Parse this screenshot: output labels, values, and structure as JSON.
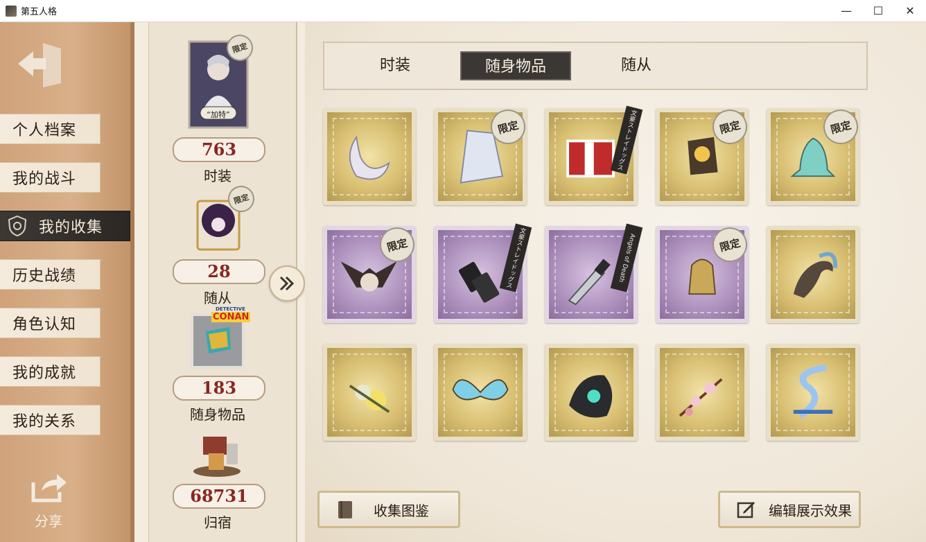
{
  "window": {
    "title": "第五人格",
    "controls": [
      "—",
      "☐",
      "✕"
    ]
  },
  "sidebar": {
    "items": [
      {
        "label": "个人档案",
        "active": false
      },
      {
        "label": "我的战斗",
        "active": false
      },
      {
        "label": "我的收集",
        "active": true
      },
      {
        "label": "历史战绩",
        "active": false
      },
      {
        "label": "角色认知",
        "active": false
      },
      {
        "label": "我的成就",
        "active": false
      },
      {
        "label": "我的关系",
        "active": false
      }
    ],
    "share_label": "分享"
  },
  "stats": [
    {
      "label": "时装",
      "count": "763",
      "badge": "限定",
      "thumb_caption": "“加特”"
    },
    {
      "label": "随从",
      "count": "28",
      "badge": "限定"
    },
    {
      "label": "随身物品",
      "count": "183",
      "badge": "CONAN",
      "badge_top": "DETECTIVE"
    },
    {
      "label": "归宿",
      "count": "68731"
    }
  ],
  "tabs": [
    {
      "label": "时装",
      "active": false
    },
    {
      "label": "随身物品",
      "active": true
    },
    {
      "label": "随从",
      "active": false
    }
  ],
  "items": [
    {
      "frame": "gold",
      "icon": "crescent-moon-item-icon",
      "tag": ""
    },
    {
      "frame": "gold",
      "icon": "crystal-cape-item-icon",
      "tag": "限定"
    },
    {
      "frame": "gold",
      "icon": "red-book-item-icon",
      "tag": "文豪ストレイドッグス"
    },
    {
      "frame": "gold",
      "icon": "lantern-item-icon",
      "tag": "限定"
    },
    {
      "frame": "gold",
      "icon": "dragon-statue-item-icon",
      "tag": "限定"
    },
    {
      "frame": "purple",
      "icon": "winged-mask-item-icon",
      "tag": "限定"
    },
    {
      "frame": "purple",
      "icon": "flip-phone-item-icon",
      "tag": "文豪ストレイドッグス"
    },
    {
      "frame": "purple",
      "icon": "knife-item-icon",
      "tag": "Angels of Death"
    },
    {
      "frame": "purple",
      "icon": "bell-cage-item-icon",
      "tag": "限定"
    },
    {
      "frame": "gold",
      "icon": "sea-creature-item-icon",
      "tag": ""
    },
    {
      "frame": "gold",
      "icon": "yellow-roses-item-icon",
      "tag": ""
    },
    {
      "frame": "gold",
      "icon": "butterfly-item-icon",
      "tag": ""
    },
    {
      "frame": "gold",
      "icon": "dark-orb-item-icon",
      "tag": ""
    },
    {
      "frame": "gold",
      "icon": "cherry-blossom-item-icon",
      "tag": ""
    },
    {
      "frame": "gold",
      "icon": "dna-crystal-item-icon",
      "tag": ""
    }
  ],
  "buttons": {
    "catalog": "收集图鉴",
    "edit_display": "编辑展示效果"
  },
  "colors": {
    "accent_red": "#8a2622",
    "active_tab": "#3a3734",
    "gold_frame": "#d8bf72",
    "purple_frame": "#b094bf"
  }
}
